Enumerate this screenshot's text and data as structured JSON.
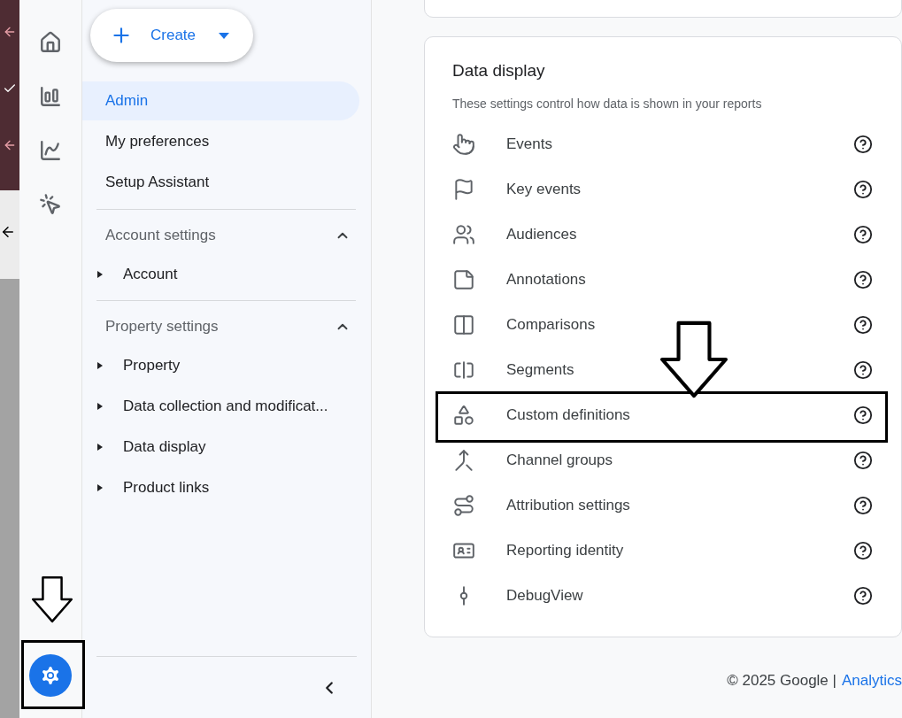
{
  "nav_rail": [
    {
      "kind": "home",
      "selected": false
    },
    {
      "kind": "reports",
      "selected": false
    },
    {
      "kind": "explore",
      "selected": false
    },
    {
      "kind": "advertising",
      "selected": false
    },
    {
      "kind": "admin",
      "selected": true
    }
  ],
  "sidebar": {
    "create_button": "Create",
    "items": [
      {
        "label": "Admin",
        "selected": true
      },
      {
        "label": "My preferences",
        "selected": false
      },
      {
        "label": "Setup Assistant",
        "selected": false
      }
    ],
    "sections": [
      {
        "title": "Account settings",
        "expanded": true,
        "children": [
          {
            "label": "Account"
          }
        ]
      },
      {
        "title": "Property settings",
        "expanded": true,
        "children": [
          {
            "label": "Property"
          },
          {
            "label": "Data collection and modificat..."
          },
          {
            "label": "Data display"
          },
          {
            "label": "Product links"
          }
        ]
      }
    ]
  },
  "card": {
    "title": "Data display",
    "subtitle": "These settings control how data is shown in your reports",
    "items": [
      {
        "kind": "events",
        "label": "Events",
        "highlighted": false
      },
      {
        "kind": "key_events",
        "label": "Key events",
        "highlighted": false
      },
      {
        "kind": "audiences",
        "label": "Audiences",
        "highlighted": false
      },
      {
        "kind": "annotations",
        "label": "Annotations",
        "highlighted": false
      },
      {
        "kind": "comparisons",
        "label": "Comparisons",
        "highlighted": false
      },
      {
        "kind": "segments",
        "label": "Segments",
        "highlighted": false
      },
      {
        "kind": "custom_definitions",
        "label": "Custom definitions",
        "highlighted": true
      },
      {
        "kind": "channel_groups",
        "label": "Channel groups",
        "highlighted": false
      },
      {
        "kind": "attribution",
        "label": "Attribution settings",
        "highlighted": false
      },
      {
        "kind": "reporting_identity",
        "label": "Reporting identity",
        "highlighted": false
      },
      {
        "kind": "debugview",
        "label": "DebugView",
        "highlighted": false
      }
    ]
  },
  "footer": {
    "copyright": "© 2025 Google |",
    "link": "Analytics"
  }
}
